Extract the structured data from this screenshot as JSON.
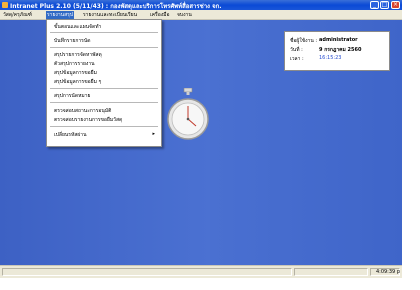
{
  "window": {
    "title": "Intranet Plus 2.10 (5/11/43) : กองพัสดุและบริการโทรศัพท์สื่อสารช่าง จก."
  },
  "menubar": {
    "items": [
      "วัสดุ/ครุภัณฑ์",
      "รายงานสรุป",
      "รายงานและทะเบียนเรียน",
      "เครื่องมือ",
      "จบงาน"
    ]
  },
  "dropdown": {
    "items": [
      "ขั้นตอนและแผนจัดทำ",
      "บันทึกรายการนัด",
      "สรุปรายการจัดหาพัสดุ",
      "ตัวสรุปการรายงาน",
      "สรุปข้อมูลการขอยืม",
      "สรุปข้อมูลการขอยืม ๆ",
      "สรุปการนัดหมาย",
      "ตรวจสอบสถานะการอนุมัติ",
      "ตรวจสอบรายงานการขอยืมวัสดุ",
      "เปลี่ยนรหัสผ่าน"
    ]
  },
  "info": {
    "user_label": "ชื่อผู้ใช้งาน :",
    "user_value": "administrator",
    "date_label": "วันที่ :",
    "date_value": "9 กรกฎาคม 2560",
    "time_label": "เวลา :",
    "time_value": "16:15:23"
  },
  "status": {
    "time": "4:09:39 p"
  },
  "colors": {
    "desktop_blue": "#3e63c7",
    "menu_active": "#316ac5",
    "title_blue": "#0b4ad6"
  }
}
